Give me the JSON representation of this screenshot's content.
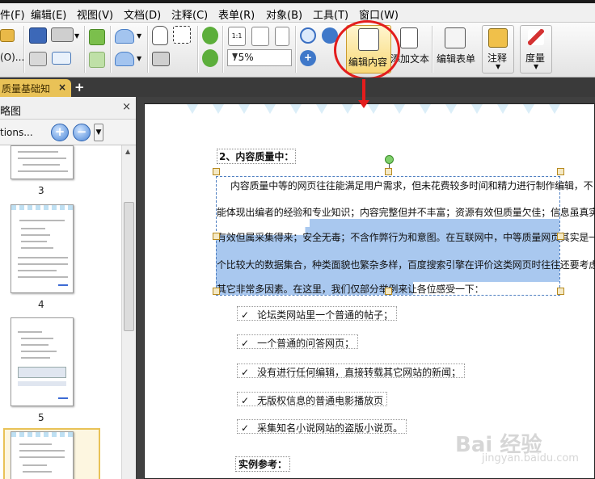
{
  "menu": [
    "件(F)",
    "编辑(E)",
    "视图(V)",
    "文档(D)",
    "注释(C)",
    "表单(R)",
    "对象(B)",
    "工具(T)",
    "窗口(W)"
  ],
  "toolbar": {
    "open_label": "(O)...",
    "zoom_value": "75%",
    "edit_content_label": "编辑内容",
    "add_text_label": "添加文本",
    "edit_form_label": "编辑表单",
    "annotate_label": "注释",
    "measure_label": "度量",
    "page_size_label": "1:1"
  },
  "tabs": {
    "doc_title": "质量基础知",
    "close": "×",
    "new_tab": "+"
  },
  "thumbnails": {
    "title": "略图",
    "close": "×",
    "options_label": "tions...",
    "pages": [
      "3",
      "4",
      "5"
    ]
  },
  "document": {
    "heading": "2、内容质量中：",
    "paragraph_lines": [
      "内容质量中等的网页往往能满足用户需求，但未花费较多时间和精力进行制作编辑，不",
      "能体现出编者的经验和专业知识；内容完整但并不丰富；资源有效但质量欠佳；信息虽真实",
      "有效但属采集得来；安全无毒；不含作弊行为和意图。在互联网中，中等质量网页其实是一",
      "个比较大的数据集合，种类面貌也繁杂多样，百度搜索引擎在评价这类网页时往往还要考虑",
      "其它非常多因素。在这里，我们仅部分举例来让各位感受一下："
    ],
    "check_mark": "✓",
    "list_items": [
      "论坛类网站里一个普通的帖子；",
      "一个普通的问答网页；",
      "没有进行任何编辑，直接转载其它网站的新闻；",
      "无版权信息的普通电影播放页",
      "采集知名小说网站的盗版小说页。"
    ],
    "subheading": "实例参考："
  },
  "watermark": {
    "brand": "Bai 经验",
    "url": "jingyan.baidu.com"
  },
  "colors": {
    "accent_red": "#e31d1d",
    "tab_gold": "#e9c257",
    "selection_blue": "#a9c8ef"
  }
}
